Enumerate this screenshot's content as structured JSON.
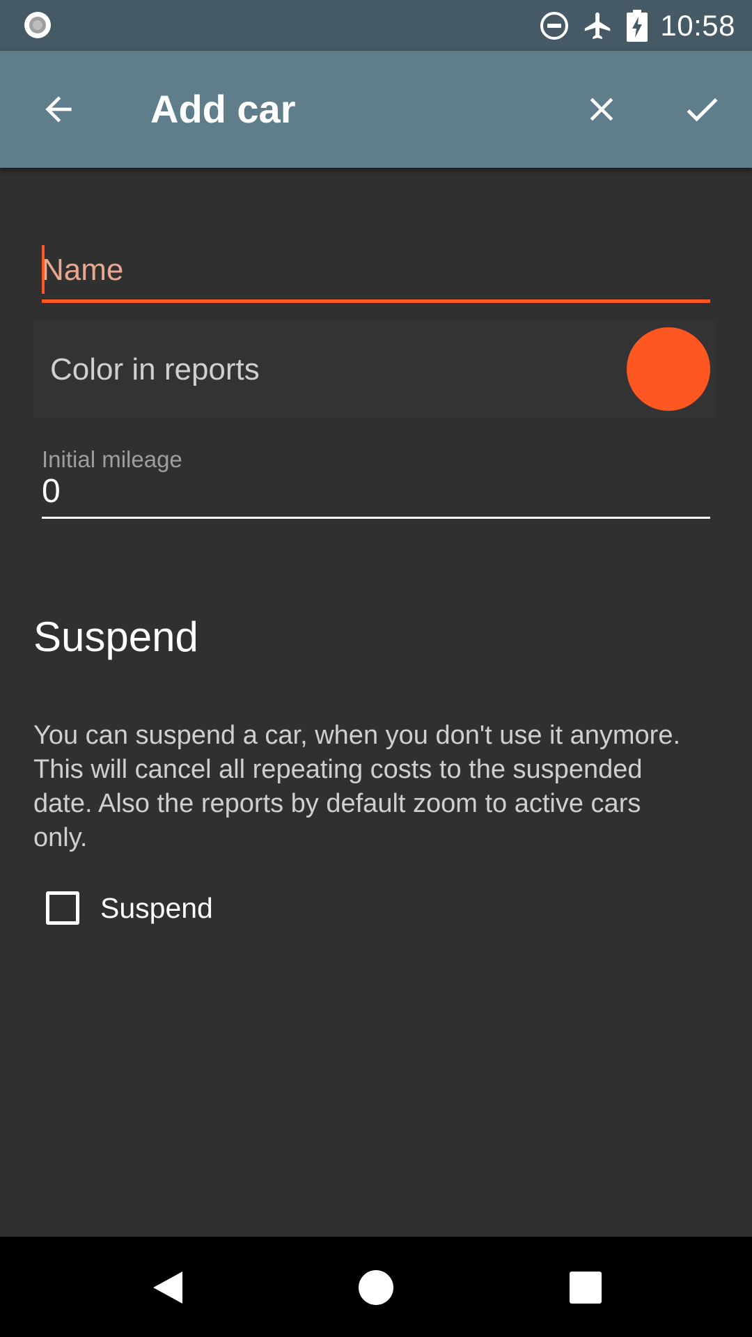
{
  "status_bar": {
    "time": "10:58",
    "icons": [
      "notification-dot-icon",
      "do-not-disturb-icon",
      "airplane-mode-icon",
      "battery-charging-icon"
    ]
  },
  "app_bar": {
    "title": "Add car",
    "icons": [
      "back-arrow-icon",
      "close-icon",
      "check-icon"
    ]
  },
  "form": {
    "name": {
      "placeholder": "Name",
      "value": ""
    },
    "color": {
      "label": "Color in reports",
      "value": "#ff5722"
    },
    "mileage": {
      "label": "Initial mileage",
      "value": "0"
    }
  },
  "suspend_section": {
    "title": "Suspend",
    "description": "You can suspend a car, when you don't use it anymore. This will cancel all repeating costs to the suspended date. Also the reports by default zoom to active cars only.",
    "checkbox_label": "Suspend",
    "checked": false
  },
  "nav_bar": {
    "icons": [
      "nav-back-icon",
      "nav-home-icon",
      "nav-recents-icon"
    ]
  },
  "colors": {
    "accent": "#ff5722",
    "app_bar": "#607d8b",
    "status_bar": "#455a64",
    "background": "#303030"
  }
}
